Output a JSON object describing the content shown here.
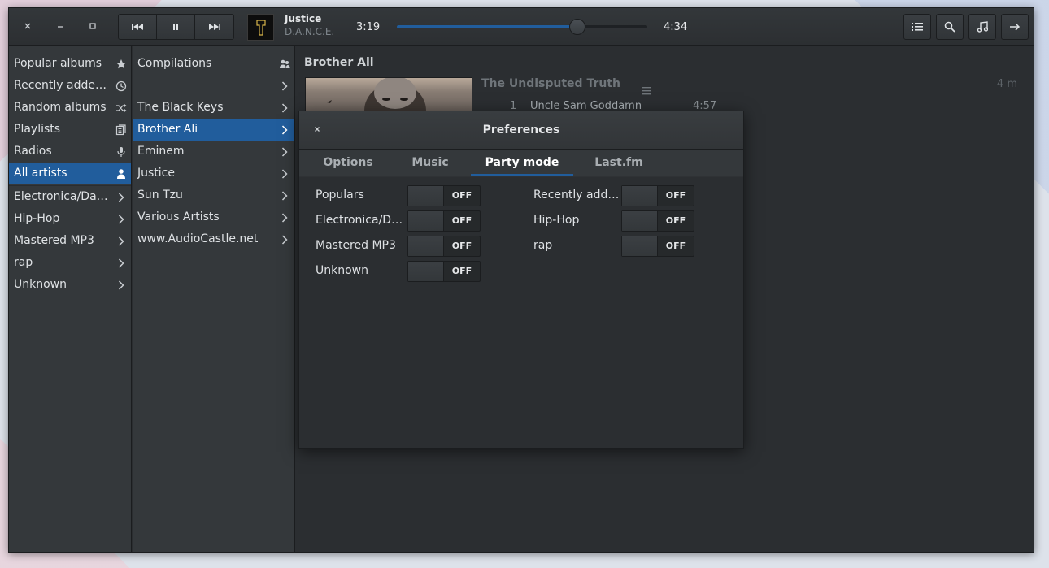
{
  "colors": {
    "accent": "#215d9c",
    "window_bg": "#2b2e31",
    "sidebar_bg": "#34383b",
    "text": "#dfe2e5",
    "muted_text": "#7f868c"
  },
  "window_controls": {
    "close_icon": "close-icon",
    "minimize_icon": "minimize-icon",
    "maximize_icon": "maximize-icon"
  },
  "player": {
    "now_playing_title": "Justice",
    "now_playing_album": "D.A.N.C.E.",
    "current_time": "3:19",
    "total_time": "4:34",
    "progress_fraction": 0.72,
    "icons": [
      "previous-icon",
      "pause-icon",
      "next-icon"
    ]
  },
  "header_right_icons": [
    "list-icon",
    "search-icon",
    "music-note-icon",
    "arrow-right-icon"
  ],
  "sidebar": {
    "items": [
      {
        "label": "Popular albums",
        "icon": "star-icon"
      },
      {
        "label": "Recently added albums",
        "icon": "clock-icon"
      },
      {
        "label": "Random albums",
        "icon": "shuffle-icon"
      },
      {
        "label": "Playlists",
        "icon": "playlist-icon"
      },
      {
        "label": "Radios",
        "icon": "microphone-icon"
      },
      {
        "label": "All artists",
        "icon": "person-icon",
        "selected": true
      },
      {
        "label": "Electronica/Dance",
        "icon": "chevron-right-icon"
      },
      {
        "label": "Hip-Hop",
        "icon": "chevron-right-icon"
      },
      {
        "label": "Mastered MP3",
        "icon": "chevron-right-icon"
      },
      {
        "label": "rap",
        "icon": "chevron-right-icon"
      },
      {
        "label": "Unknown",
        "icon": "chevron-right-icon"
      }
    ]
  },
  "artists": {
    "items": [
      {
        "label": "Compilations",
        "icon": "people-icon"
      },
      {
        "label": "",
        "icon": "chevron-right-icon"
      },
      {
        "label": "The Black Keys",
        "icon": "chevron-right-icon"
      },
      {
        "label": "Brother Ali",
        "icon": "chevron-right-icon",
        "selected": true
      },
      {
        "label": "Eminem",
        "icon": "chevron-right-icon"
      },
      {
        "label": "Justice",
        "icon": "chevron-right-icon"
      },
      {
        "label": "Sun Tzu",
        "icon": "chevron-right-icon"
      },
      {
        "label": "Various Artists",
        "icon": "chevron-right-icon"
      },
      {
        "label": "www.AudioCastle.net",
        "icon": "chevron-right-icon"
      }
    ]
  },
  "main": {
    "artist_heading": "Brother Ali",
    "album_title": "The Undisputed Truth",
    "album_duration": "4 m",
    "tracks": [
      {
        "num": "1",
        "name": "Uncle Sam Goddamn",
        "length": "4:57"
      }
    ]
  },
  "preferences": {
    "title": "Preferences",
    "tabs": [
      "Options",
      "Music",
      "Party mode",
      "Last.fm"
    ],
    "active_tab": "Party mode",
    "toggles_left": [
      {
        "label": "Populars",
        "state": "OFF"
      },
      {
        "label": "Electronica/Dance",
        "state": "OFF"
      },
      {
        "label": "Mastered MP3",
        "state": "OFF"
      },
      {
        "label": "Unknown",
        "state": "OFF"
      }
    ],
    "toggles_right": [
      {
        "label": "Recently added",
        "state": "OFF"
      },
      {
        "label": "Hip-Hop",
        "state": "OFF"
      },
      {
        "label": "rap",
        "state": "OFF"
      }
    ]
  }
}
